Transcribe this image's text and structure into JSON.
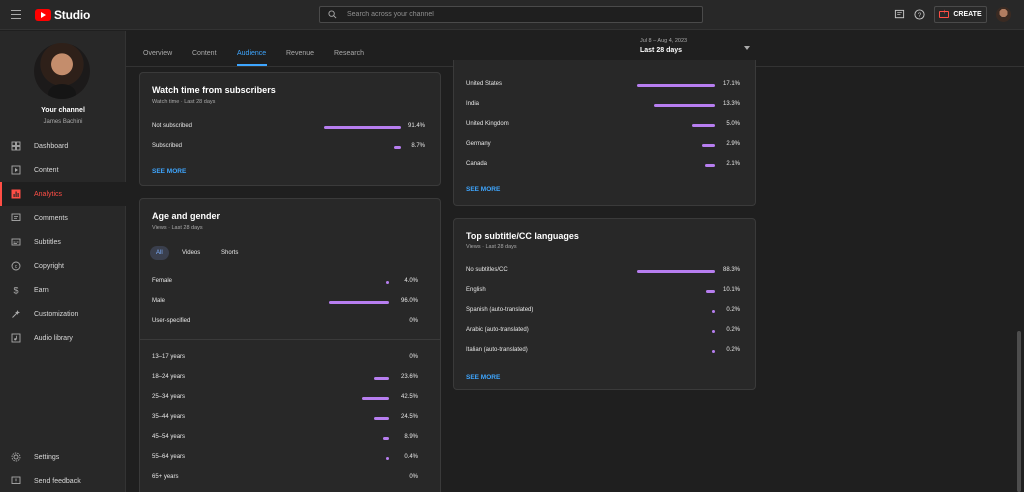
{
  "app": {
    "logo_text": "Studio",
    "brand_color": "#ff0000",
    "accent_color": "#3ea6ff",
    "bar_color": "#b77ef0"
  },
  "header": {
    "search_placeholder": "Search across your channel",
    "create_label": "CREATE"
  },
  "sidebar": {
    "channel_title": "Your channel",
    "channel_name": "James Bachini",
    "items": [
      {
        "label": "Dashboard",
        "icon": "dashboard-icon"
      },
      {
        "label": "Content",
        "icon": "content-icon"
      },
      {
        "label": "Analytics",
        "icon": "analytics-icon",
        "active": true
      },
      {
        "label": "Comments",
        "icon": "comments-icon"
      },
      {
        "label": "Subtitles",
        "icon": "subtitles-icon"
      },
      {
        "label": "Copyright",
        "icon": "copyright-icon"
      },
      {
        "label": "Earn",
        "icon": "earn-icon"
      },
      {
        "label": "Customization",
        "icon": "customization-icon"
      },
      {
        "label": "Audio library",
        "icon": "audio-library-icon"
      }
    ],
    "settings_label": "Settings",
    "feedback_label": "Send feedback"
  },
  "tabs": [
    {
      "label": "Overview"
    },
    {
      "label": "Content"
    },
    {
      "label": "Audience",
      "active": true
    },
    {
      "label": "Revenue"
    },
    {
      "label": "Research"
    }
  ],
  "date_picker": {
    "range": "Jul 8 – Aug 4, 2023",
    "label": "Last 28 days"
  },
  "watch_time": {
    "title": "Watch time from subscribers",
    "subtitle": "Watch time · Last 28 days",
    "rows": [
      {
        "label": "Not subscribed",
        "value": "91.4%",
        "share": 0.914
      },
      {
        "label": "Subscribed",
        "value": "8.7%",
        "share": 0.087
      }
    ],
    "see_more": "SEE MORE"
  },
  "age_gender": {
    "title": "Age and gender",
    "subtitle": "Views · Last 28 days",
    "chips": [
      {
        "label": "All",
        "active": true
      },
      {
        "label": "Videos"
      },
      {
        "label": "Shorts"
      }
    ],
    "gender_rows": [
      {
        "label": "Female",
        "value": "4.0%",
        "share": 0.04
      },
      {
        "label": "Male",
        "value": "96.0%",
        "share": 0.96
      },
      {
        "label": "User-specified",
        "value": "0%",
        "share": 0
      }
    ],
    "age_rows": [
      {
        "label": "13–17 years",
        "value": "0%",
        "share": 0
      },
      {
        "label": "18–24 years",
        "value": "23.6%",
        "share": 0.236
      },
      {
        "label": "25–34 years",
        "value": "42.5%",
        "share": 0.425
      },
      {
        "label": "35–44 years",
        "value": "24.5%",
        "share": 0.245
      },
      {
        "label": "45–54 years",
        "value": "8.9%",
        "share": 0.089
      },
      {
        "label": "55–64 years",
        "value": "0.4%",
        "share": 0.004
      },
      {
        "label": "65+ years",
        "value": "0%",
        "share": 0
      }
    ]
  },
  "geography": {
    "rows": [
      {
        "label": "United States",
        "value": "17.1%",
        "share": 0.171
      },
      {
        "label": "India",
        "value": "13.3%",
        "share": 0.133
      },
      {
        "label": "United Kingdom",
        "value": "5.0%",
        "share": 0.05
      },
      {
        "label": "Germany",
        "value": "2.9%",
        "share": 0.029
      },
      {
        "label": "Canada",
        "value": "2.1%",
        "share": 0.021
      }
    ],
    "see_more": "SEE MORE"
  },
  "subtitles": {
    "title": "Top subtitle/CC languages",
    "subtitle": "Views · Last 28 days",
    "rows": [
      {
        "label": "No subtitles/CC",
        "value": "88.3%",
        "share": 0.883
      },
      {
        "label": "English",
        "value": "10.1%",
        "share": 0.101
      },
      {
        "label": "Spanish (auto-translated)",
        "value": "0.2%",
        "share": 0.002
      },
      {
        "label": "Arabic (auto-translated)",
        "value": "0.2%",
        "share": 0.002
      },
      {
        "label": "Italian (auto-translated)",
        "value": "0.2%",
        "share": 0.002
      }
    ],
    "see_more": "SEE MORE"
  }
}
